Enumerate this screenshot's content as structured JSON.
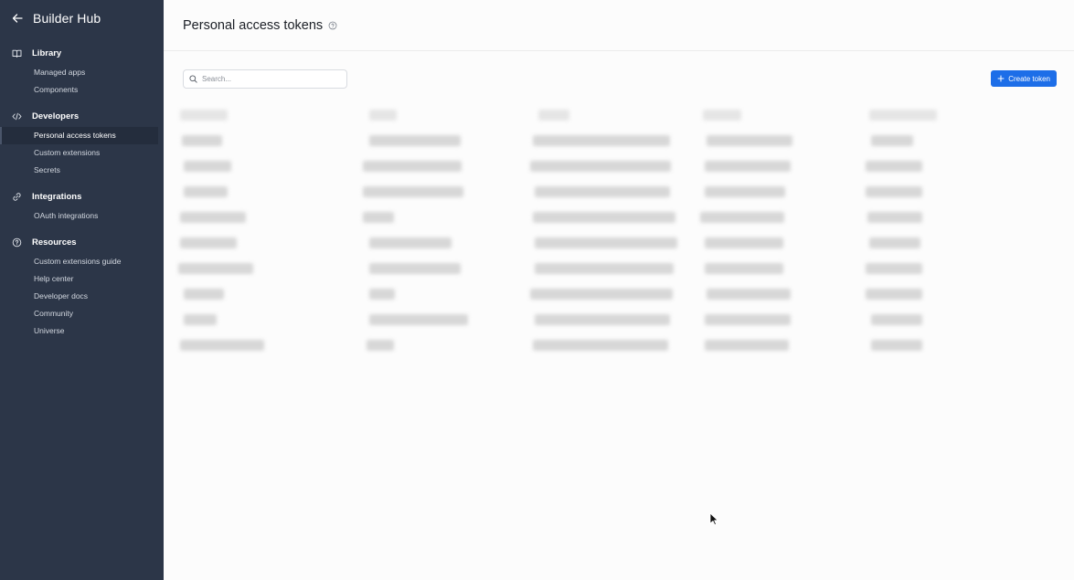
{
  "sidebar": {
    "app_title": "Builder Hub",
    "sections": [
      {
        "title": "Library",
        "icon": "book-icon",
        "items": [
          "Managed apps",
          "Components"
        ]
      },
      {
        "title": "Developers",
        "icon": "code-icon",
        "items": [
          "Personal access tokens",
          "Custom extensions",
          "Secrets"
        ],
        "active": "Personal access tokens"
      },
      {
        "title": "Integrations",
        "icon": "link-icon",
        "items": [
          "OAuth integrations"
        ]
      },
      {
        "title": "Resources",
        "icon": "question-circle-icon",
        "items": [
          "Custom extensions guide",
          "Help center",
          "Developer docs",
          "Community",
          "Universe"
        ]
      }
    ]
  },
  "header": {
    "title": "Personal access tokens"
  },
  "toolbar": {
    "search_placeholder": "Search...",
    "create_label": "Create token"
  },
  "colors": {
    "sidebar_bg": "#2c3648",
    "accent": "#1d6ee8"
  }
}
